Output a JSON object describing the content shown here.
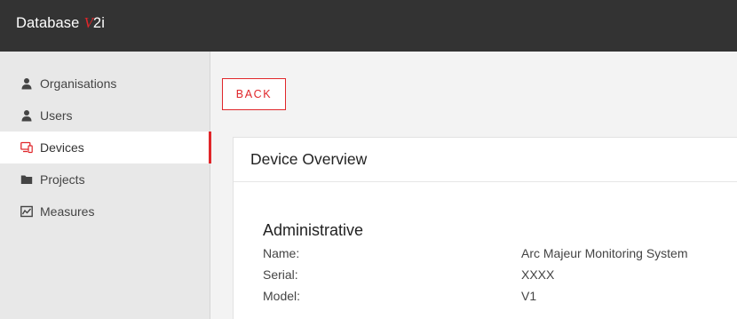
{
  "app": {
    "title_main": "Database",
    "title_v": "V",
    "title_suffix": "2i"
  },
  "sidebar": {
    "items": [
      {
        "label": "Organisations",
        "icon": "user-icon",
        "active": false
      },
      {
        "label": "Users",
        "icon": "user-icon",
        "active": false
      },
      {
        "label": "Devices",
        "icon": "devices-icon",
        "active": true
      },
      {
        "label": "Projects",
        "icon": "folder-icon",
        "active": false
      },
      {
        "label": "Measures",
        "icon": "chart-line-icon",
        "active": false
      }
    ]
  },
  "main": {
    "back_label": "BACK",
    "card": {
      "title": "Device Overview",
      "section_title": "Administrative",
      "fields": [
        {
          "label": "Name:",
          "value": "Arc Majeur Monitoring System"
        },
        {
          "label": "Serial:",
          "value": "XXXX"
        },
        {
          "label": "Model:",
          "value": "V1"
        }
      ]
    }
  },
  "colors": {
    "topbar": "#333333",
    "accent": "#e0262a",
    "sidebar_bg": "#e8e8e8"
  }
}
